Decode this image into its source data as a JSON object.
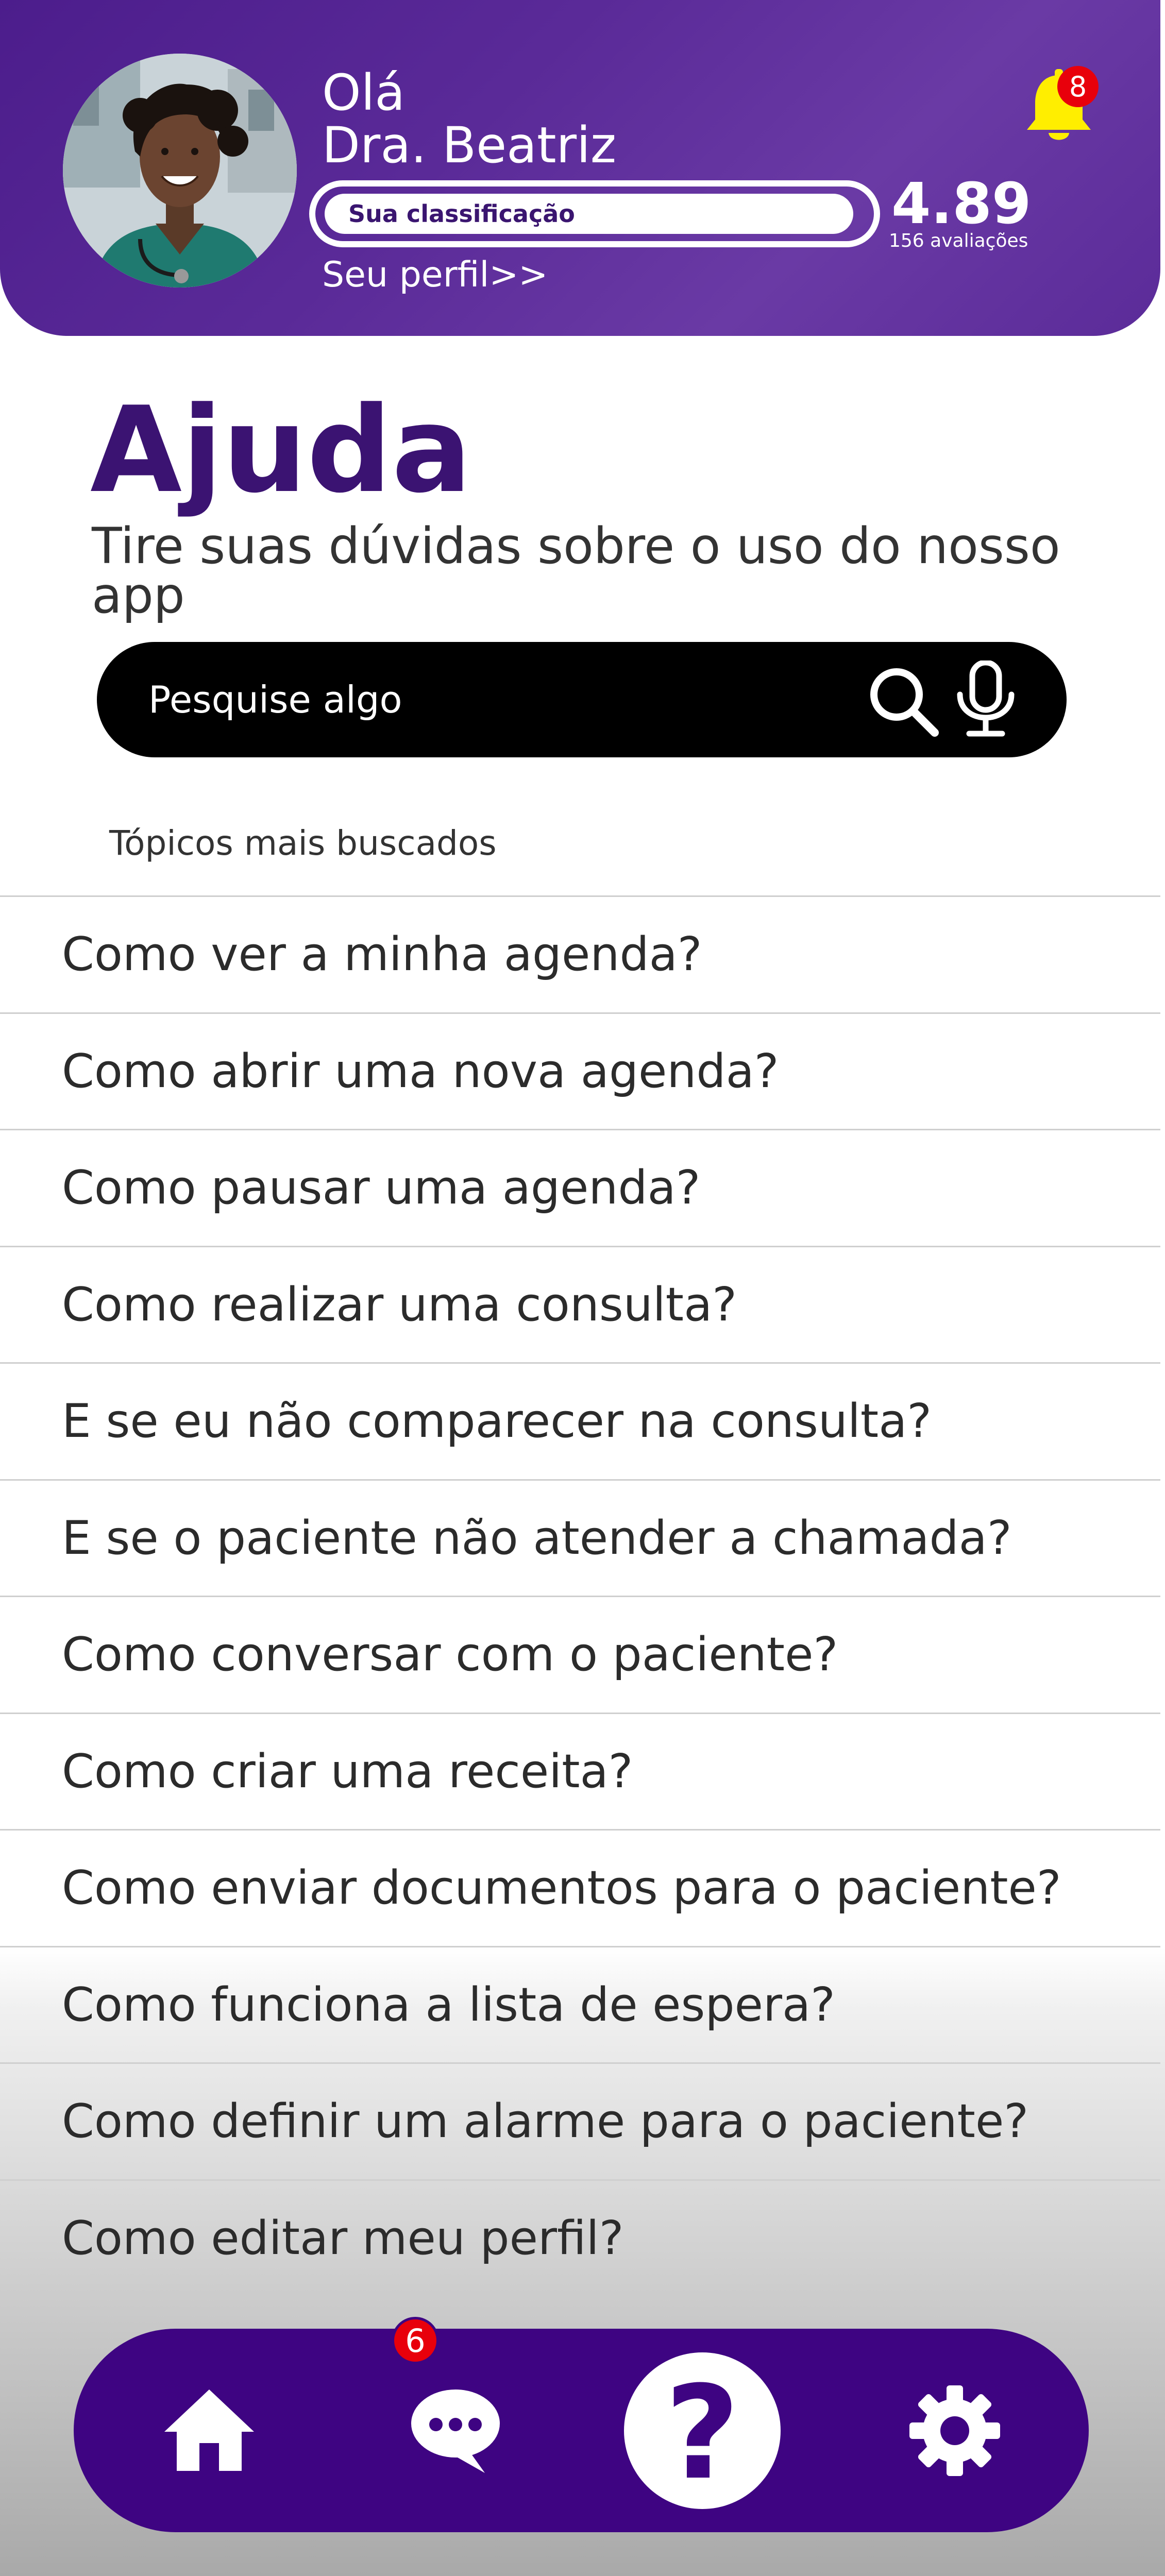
{
  "header": {
    "greeting": "Olá",
    "name": "Dra. Beatriz",
    "rating_label": "Sua classificação",
    "rating_value": "4.89",
    "rating_count": "156 avaliações",
    "profile_link": "Seu perfil>>",
    "notifications_count": "8",
    "bell_icon": "bell-icon",
    "colors": {
      "header_bg": "#5a2a98",
      "bell": "#ffee00",
      "badge": "#e8000b"
    }
  },
  "page": {
    "title": "Ajuda",
    "subtitle": "Tire suas dúvidas sobre o uso do nosso app"
  },
  "search": {
    "placeholder": "Pesquise algo",
    "search_icon": "search-icon",
    "mic_icon": "microphone-icon"
  },
  "topics": {
    "label": "Tópicos mais buscados",
    "items": [
      "Como ver a minha agenda?",
      "Como abrir uma nova agenda?",
      "Como pausar uma agenda?",
      "Como realizar uma consulta?",
      "E se eu não comparecer na consulta?",
      "E se o paciente não atender a chamada?",
      "Como conversar com o paciente?",
      "Como criar uma receita?",
      "Como enviar documentos para o paciente?",
      "Como funciona a lista de espera?",
      "Como definir um alarme para o paciente?",
      "Como editar meu perfil?"
    ]
  },
  "nav": {
    "items": [
      "home-icon",
      "chat-icon",
      "help-icon",
      "gear-icon"
    ],
    "active": "help",
    "chat_badge": "6",
    "help_glyph": "?",
    "colors": {
      "nav_bg": "#3e0482",
      "title": "#3b1372"
    }
  }
}
